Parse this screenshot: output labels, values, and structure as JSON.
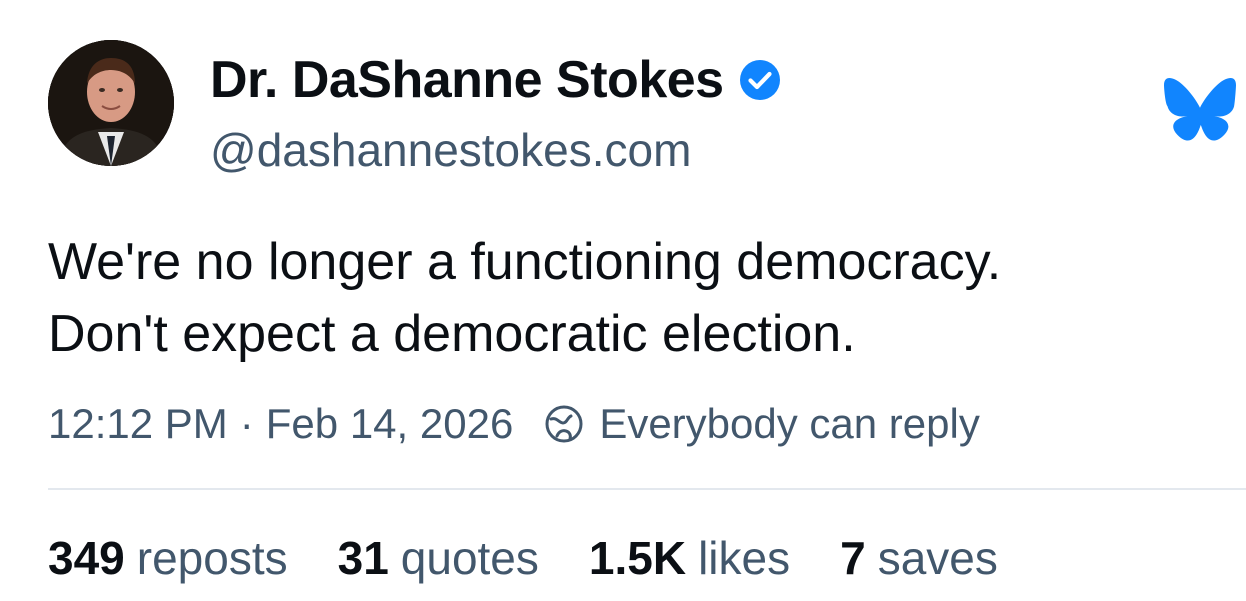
{
  "author": {
    "display_name": "Dr. DaShanne Stokes",
    "handle": "@dashannestokes.com",
    "verified_icon": "verified-badge-icon",
    "avatar_icon": "profile-avatar"
  },
  "post": {
    "lines": [
      "We're no longer a functioning democracy.",
      "Don't expect a democratic election."
    ]
  },
  "meta": {
    "time": "12:12 PM",
    "separator": "·",
    "date": "Feb 14, 2026",
    "reply_setting": "Everybody can reply",
    "reply_icon": "globe-icon"
  },
  "stats": [
    {
      "value": "349",
      "label": "reposts"
    },
    {
      "value": "31",
      "label": "quotes"
    },
    {
      "value": "1.5K",
      "label": "likes"
    },
    {
      "value": "7",
      "label": "saves"
    }
  ],
  "brand": {
    "logo_icon": "bluesky-butterfly-icon",
    "accent": "#1185fe",
    "text_primary": "#0b0f14",
    "text_secondary": "#42576c",
    "divider": "#e3e8ee"
  }
}
